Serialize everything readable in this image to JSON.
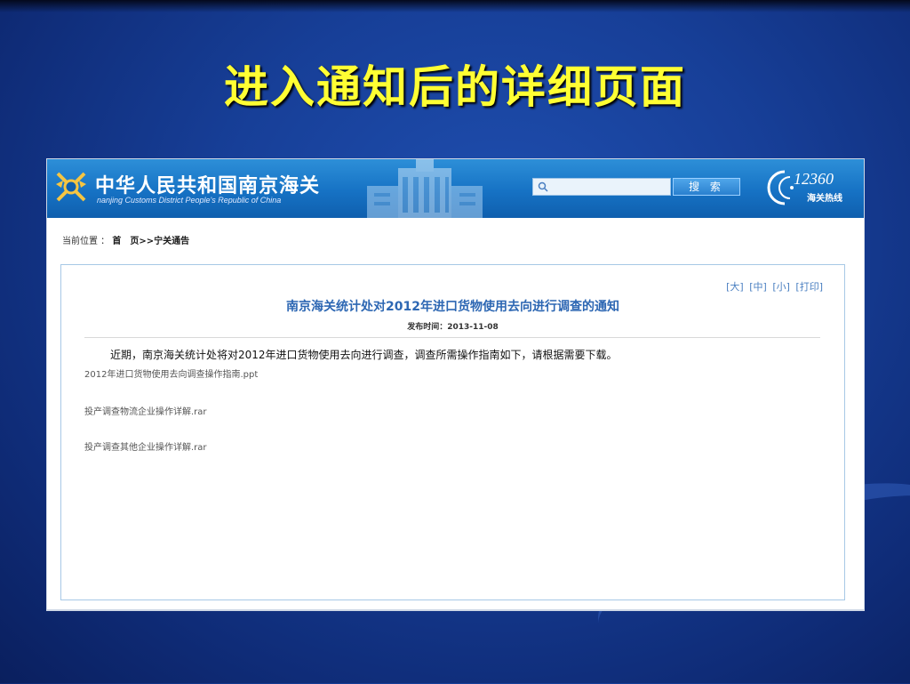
{
  "slide": {
    "title": "进入通知后的详细页面"
  },
  "header": {
    "site_name_cn": "中华人民共和国南京海关",
    "site_name_en": "nanjing Customs District People's Republic of China",
    "search_placeholder": "",
    "search_button": "搜 索",
    "hotline_number": "12360",
    "hotline_label": "海关热线"
  },
  "breadcrumb": {
    "prefix": "当前位置 ：",
    "home": "首　页",
    "separator": ">>",
    "current": "宁关通告"
  },
  "article": {
    "font_controls": [
      "[大]",
      "[中]",
      "[小]",
      "[打印]"
    ],
    "title": "南京海关统计处对2012年进口货物使用去向进行调查的通知",
    "publish_time": "发布时间：2013-11-08",
    "body": "近期，南京海关统计处将对2012年进口货物使用去向进行调查，调查所需操作指南如下，请根据需要下载。",
    "attachments": [
      "2012年进口货物使用去向调查操作指南.ppt",
      "投产调查物流企业操作详解.rar",
      "投产调查其他企业操作详解.rar"
    ]
  },
  "colors": {
    "slide_background": "#173f98",
    "title_yellow": "#ffff33",
    "header_blue": "#1672c4",
    "link_blue": "#2d67b3"
  }
}
